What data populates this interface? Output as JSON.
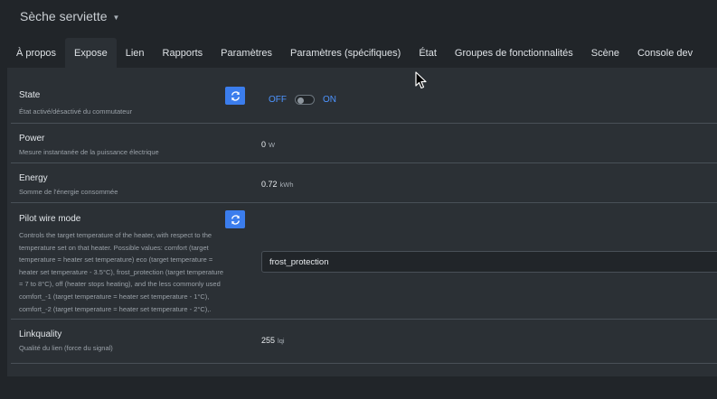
{
  "header": {
    "device_title": "Sèche serviette"
  },
  "tabs": [
    {
      "label": "À propos",
      "active": false
    },
    {
      "label": "Expose",
      "active": true
    },
    {
      "label": "Lien",
      "active": false
    },
    {
      "label": "Rapports",
      "active": false
    },
    {
      "label": "Paramètres",
      "active": false
    },
    {
      "label": "Paramètres (spécifiques)",
      "active": false
    },
    {
      "label": "État",
      "active": false
    },
    {
      "label": "Groupes de fonctionnalités",
      "active": false
    },
    {
      "label": "Scène",
      "active": false
    },
    {
      "label": "Console dev",
      "active": false
    }
  ],
  "exposes": {
    "state": {
      "name": "State",
      "description": "État activé/désactivé du commutateur",
      "off_label": "OFF",
      "on_label": "ON",
      "switch_on": false
    },
    "power": {
      "name": "Power",
      "description": "Mesure instantanée de la puissance électrique",
      "value": "0",
      "unit": "W"
    },
    "energy": {
      "name": "Energy",
      "description": "Somme de l'énergie consommée",
      "value": "0.72",
      "unit": "kWh"
    },
    "pilot_wire": {
      "name": "Pilot wire mode",
      "description_lines": [
        "Controls the target temperature of the heater, with respect to the",
        "temperature set on that heater. Possible values: comfort (target",
        "temperature = heater set temperature) eco (target temperature =",
        "heater set temperature - 3.5°C), frost_protection (target temperature",
        "= 7 to 8°C), off (heater stops heating), and the less commonly used",
        "comfort_-1 (target temperature = heater set temperature - 1°C),",
        "comfort_-2 (target temperature = heater set temperature - 2°C),."
      ],
      "selected": "frost_protection"
    },
    "linkquality": {
      "name": "Linkquality",
      "description": "Qualité du lien (force du signal)",
      "value": "255",
      "unit": "lqi"
    }
  },
  "colors": {
    "background": "#212529",
    "panel": "#2b3035",
    "accent": "#3b7ded",
    "toggle_text": "#4d94ff",
    "divider": "#495057"
  },
  "icons": {
    "refresh": "refresh-icon",
    "chevron": "chevron-down-icon",
    "cursor": "mouse-cursor-icon"
  }
}
